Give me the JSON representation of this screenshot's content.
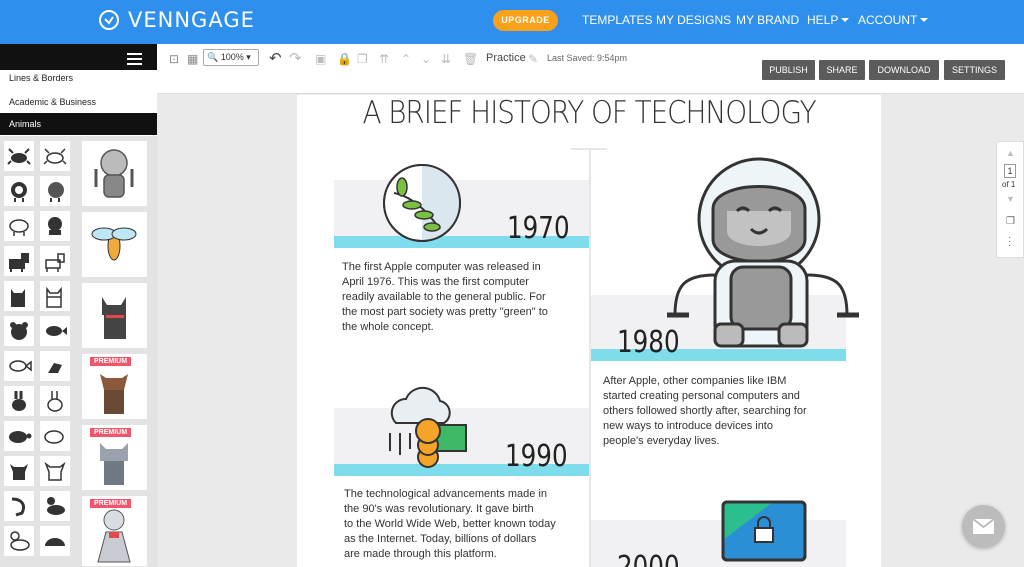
{
  "app": {
    "name": "VENNGAGE"
  },
  "header": {
    "upgrade_label": "UPGRADE",
    "nav": [
      "TEMPLATES",
      "MY DESIGNS",
      "MY BRAND",
      "HELP",
      "ACCOUNT"
    ]
  },
  "sidebar": {
    "categories": [
      "Lines & Borders",
      "Academic & Business",
      "Animals"
    ],
    "active_category": "Animals",
    "premium_label": "PREMIUM"
  },
  "toolbar": {
    "zoom": "100%",
    "doc_name": "Practice",
    "last_saved": "Last Saved: 9:54pm",
    "actions": [
      "PUBLISH",
      "SHARE",
      "DOWNLOAD",
      "SETTINGS"
    ]
  },
  "pager": {
    "current": "1",
    "total": "of 1"
  },
  "infographic": {
    "title": "A BRIEF HISTORY OF TECHNOLOGY",
    "entries": [
      {
        "year": "1970",
        "text": [
          "The first Apple computer was released in",
          "April 1976. This was the first computer",
          "readily available to the general public. For",
          "the most part society was pretty \"green\" to",
          "the whole concept."
        ]
      },
      {
        "year": "1980",
        "text": [
          "After Apple, other companies like IBM",
          "started creating personal computers and",
          "others followed shortly after, searching for",
          "new ways to introduce devices into",
          "people's everyday lives."
        ]
      },
      {
        "year": "1990",
        "text": [
          "The technological advancements made in",
          "the 90's was revolutionary. It gave birth",
          "to the World Wide Web, better known today",
          "as the Internet. Today, billions of dollars",
          "are made through this platform."
        ]
      },
      {
        "year": "2000",
        "text": []
      }
    ]
  },
  "colors": {
    "brand": "#2e8fed",
    "upgrade": "#f9a11b",
    "accent_band": "#7fdcec",
    "premium": "#f0566a"
  }
}
